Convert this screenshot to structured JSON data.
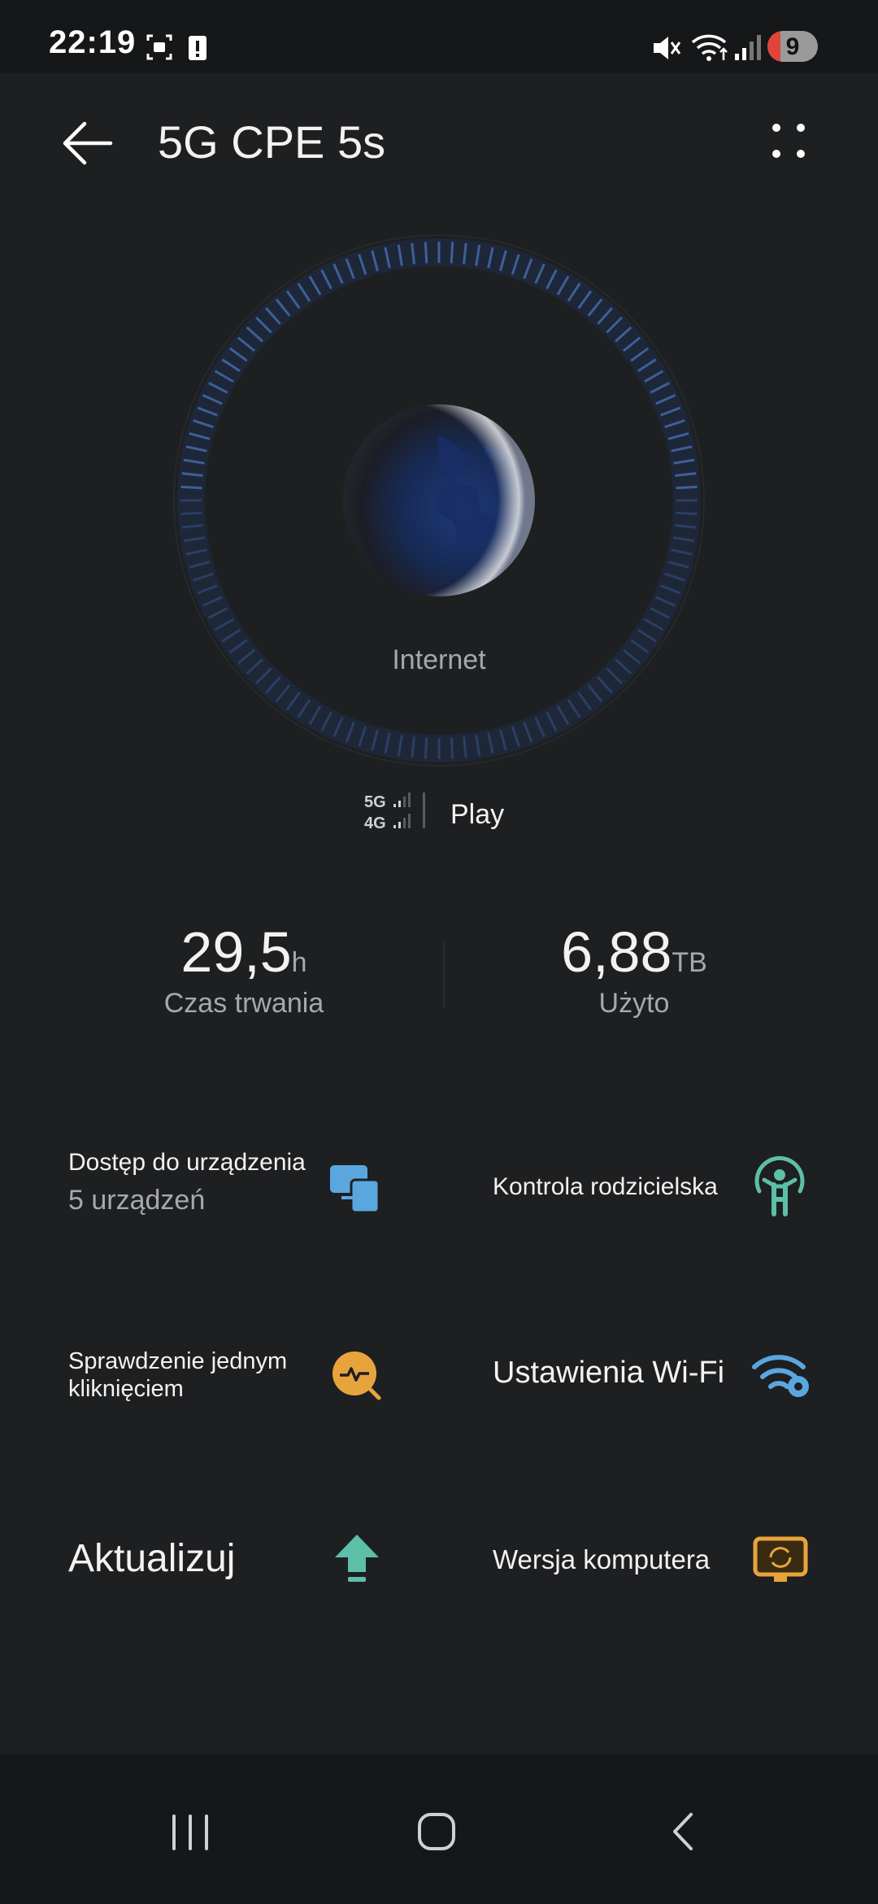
{
  "status_bar": {
    "time": "22:19",
    "battery_level": "9",
    "icons": [
      "screenshot-icon",
      "alert-icon",
      "mute-icon",
      "wifi-icon",
      "signal-icon",
      "battery-icon"
    ]
  },
  "app_bar": {
    "title": "5G CPE 5s",
    "back_icon": "arrow-left-icon",
    "more_icon": "more-icon"
  },
  "status_circle": {
    "label": "Internet"
  },
  "network": {
    "badges": [
      "5G",
      "4G"
    ],
    "operator": "Play"
  },
  "stats": {
    "duration": {
      "value": "29,5",
      "unit": "h",
      "label": "Czas trwania"
    },
    "used": {
      "value": "6,88",
      "unit": "TB",
      "label": "Użyto"
    }
  },
  "tiles": {
    "device_access": {
      "label": "Dostęp do urządzenia",
      "sub": "5 urządzeń",
      "icon": "devices-icon"
    },
    "parental_control": {
      "label": "Kontrola rodzicielska",
      "icon": "child-icon"
    },
    "one_click_check": {
      "label_line1": "Sprawdzenie jednym",
      "label_line2": "kliknięciem",
      "icon": "diagnose-icon"
    },
    "wifi_settings": {
      "label": "Ustawienia Wi-Fi",
      "icon": "wifi-settings-icon"
    },
    "update": {
      "label": "Aktualizuj",
      "icon": "upload-arrow-icon"
    },
    "desktop_version": {
      "label": "Wersja komputera",
      "icon": "desktop-icon"
    }
  },
  "colors": {
    "background": "#1e1f21",
    "tile_blue": "#5aa7e0",
    "tile_green": "#5dbfa8",
    "tile_orange": "#e8a43c",
    "ring_blue": "#2e4a7c"
  }
}
